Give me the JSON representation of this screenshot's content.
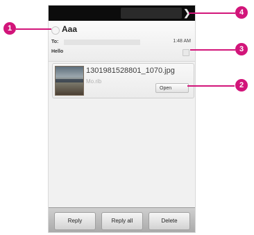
{
  "email": {
    "sender": "Aaa",
    "to_label": "To:",
    "time": "1:48 AM",
    "subject": "Hello"
  },
  "attachment": {
    "filename": "1301981528801_1070.jpg",
    "size": "Mo.rib",
    "open_label": "Open"
  },
  "actions": {
    "reply": "Reply",
    "reply_all": "Reply all",
    "delete": "Delete"
  },
  "callouts": [
    "1",
    "2",
    "3",
    "4"
  ],
  "colors": {
    "callout": "#d2157a",
    "statusbar": "#0c0c0c"
  }
}
